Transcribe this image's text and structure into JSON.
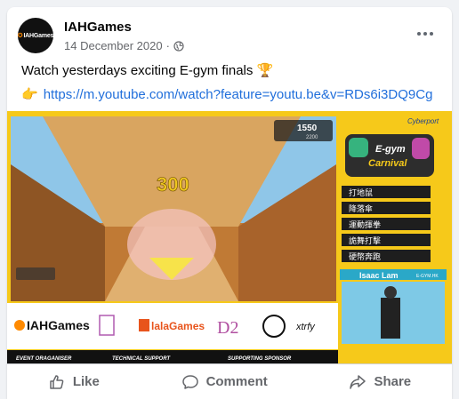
{
  "post": {
    "page_name": "IAHGames",
    "avatar_text": "IAHGames",
    "date": "14 December 2020",
    "message": "Watch yesterdays exciting E-gym finals",
    "message_emoji": "🏆",
    "link_emoji": "👉",
    "link_url": "https://m.youtube.com/watch?feature=youtu.be&v=RDs6i3DQ9Cg"
  },
  "media": {
    "score": "300",
    "top_right_score": "1550",
    "top_right_sub": "2200",
    "carnival_line1": "E-gym",
    "carnival_line2": "Carnival",
    "cyberport": "Cyberport",
    "menu_items": [
      "打地鼠",
      "降落傘",
      "運動揮拳",
      "詭舞打擊",
      "硬幣奔跑"
    ],
    "player_name": "Isaac Lam",
    "player_tag": "E-GYM.HK",
    "sponsors": {
      "iah": "IAHGames",
      "lala": "lalaGames",
      "d2": "D2",
      "xtrfy": "xtrfy"
    },
    "bottom_labels": [
      "EVENT ORAGANISER",
      "TECHNICAL SUPPORT",
      "SUPPORTING SPONSOR"
    ]
  },
  "actions": {
    "like": "Like",
    "comment": "Comment",
    "share": "Share"
  },
  "colors": {
    "link": "#216fdb",
    "muted": "#65676b",
    "banner_yellow": "#f6c91a"
  }
}
